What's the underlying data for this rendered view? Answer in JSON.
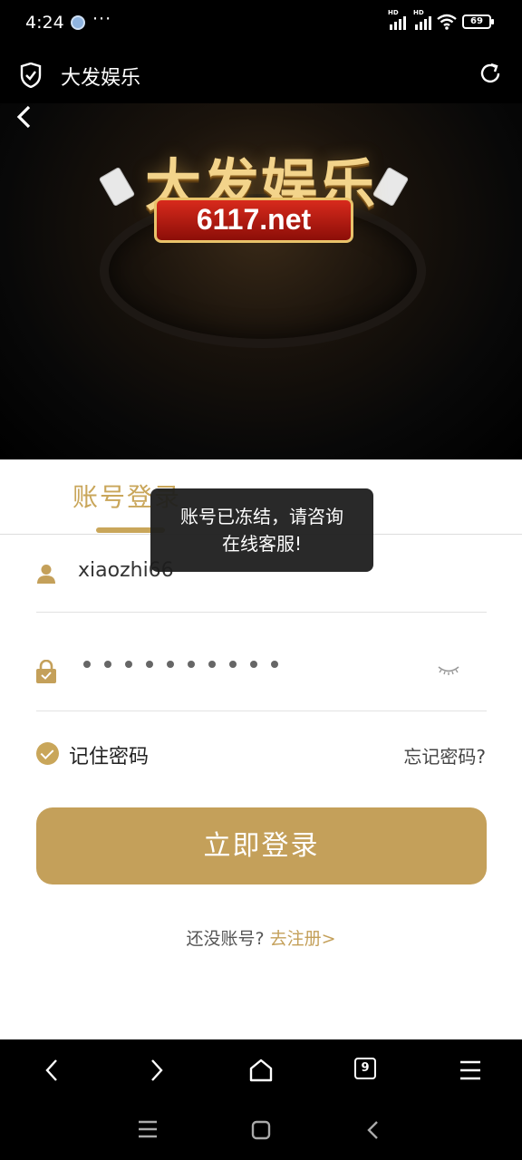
{
  "status_bar": {
    "time": "4:24",
    "more": "···",
    "network_1": "HD",
    "network_2": "HD",
    "battery": "69"
  },
  "browser": {
    "page_title": "大发娱乐",
    "tabs_count": "9"
  },
  "banner": {
    "logo_title": "大发娱乐",
    "logo_domain": "6117.net"
  },
  "login": {
    "tab_label": "账号登录",
    "username": "xiaozhi66",
    "password_mask_count": 10,
    "remember_label": "记住密码",
    "forgot_link": "忘记密码?",
    "submit_label": "立即登录",
    "register_prompt": "还没账号?",
    "register_link": "去注册>"
  },
  "toast": {
    "line1": "账号已冻结，请咨询",
    "line2": "在线客服!"
  },
  "colors": {
    "accent": "#c4a05a",
    "toast_bg": "#1e1e1e"
  }
}
